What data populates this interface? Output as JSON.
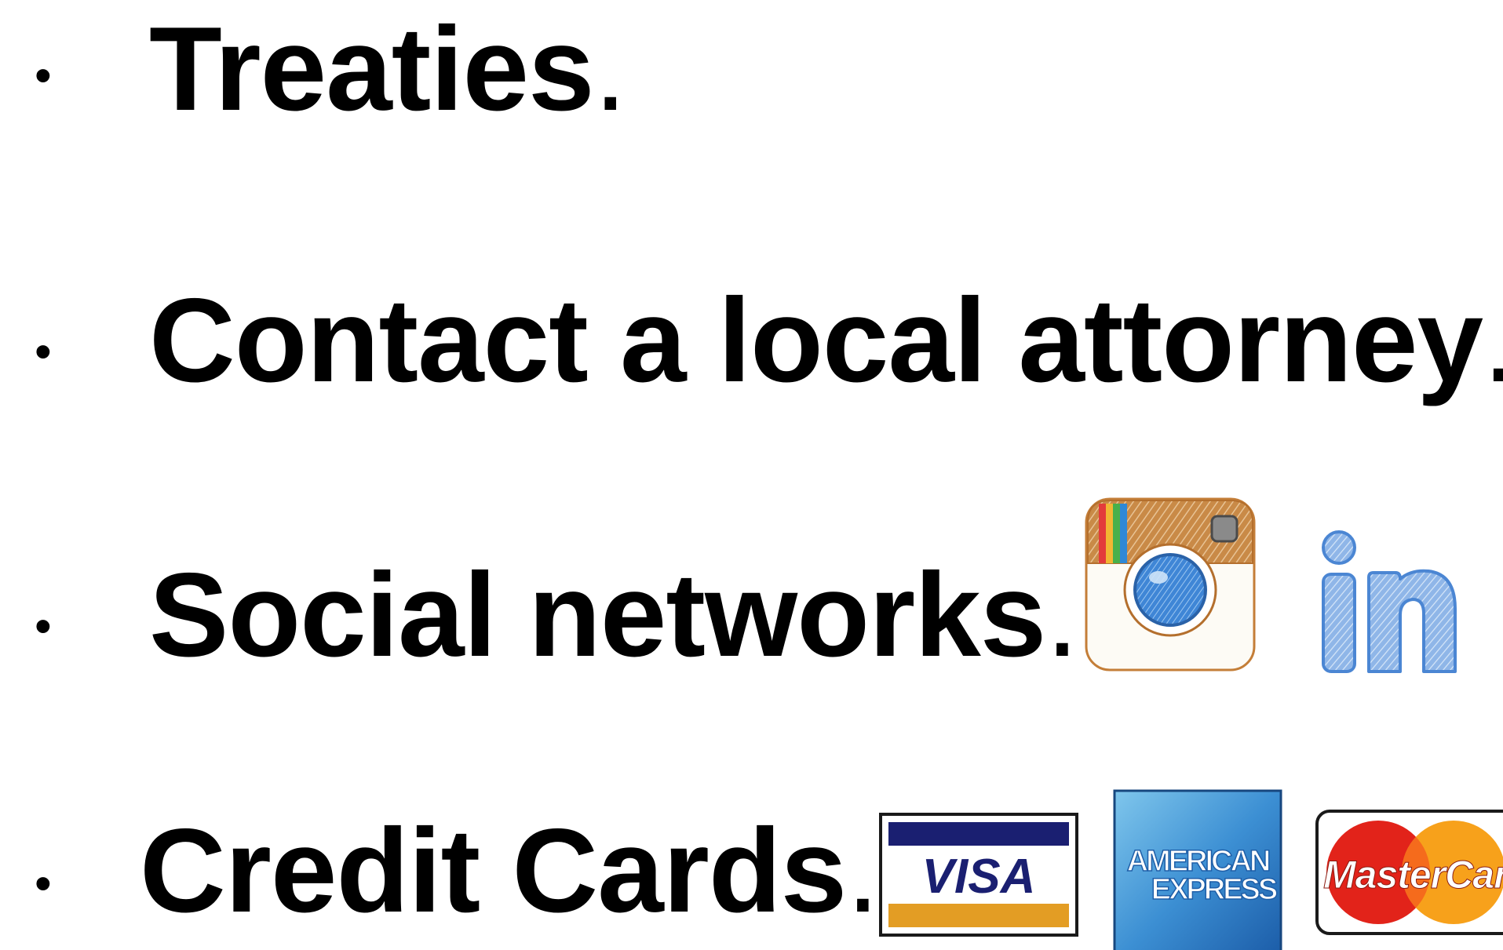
{
  "items": [
    {
      "text": "Treaties",
      "punct": "."
    },
    {
      "text": "Contact a local attorney",
      "punct": "."
    },
    {
      "text": "Social networks",
      "punct": "."
    },
    {
      "text": "Credit Cards",
      "punct": "."
    }
  ],
  "bullet": "•",
  "logos": {
    "instagram": {
      "icon": "instagram-icon",
      "colors": [
        "#b8742f",
        "#e33b3b",
        "#f2b632",
        "#48b04b",
        "#2f88d6",
        "#3b7fd8"
      ]
    },
    "linkedin": {
      "text": "in",
      "icon": "linkedin-icon",
      "color": "#4b86d3"
    },
    "visa": {
      "text": "VISA",
      "icon": "visa-logo",
      "colors": [
        "#1a1f71",
        "#e39d24"
      ]
    },
    "amex": {
      "text1": "AMERICAN",
      "text2": "EXPRESS",
      "icon": "american-express-logo",
      "color": "#2e7bc4"
    },
    "mastercard": {
      "text": "MasterCard",
      "icon": "mastercard-logo",
      "colors": [
        "#e2231a",
        "#f7a11b"
      ]
    }
  }
}
